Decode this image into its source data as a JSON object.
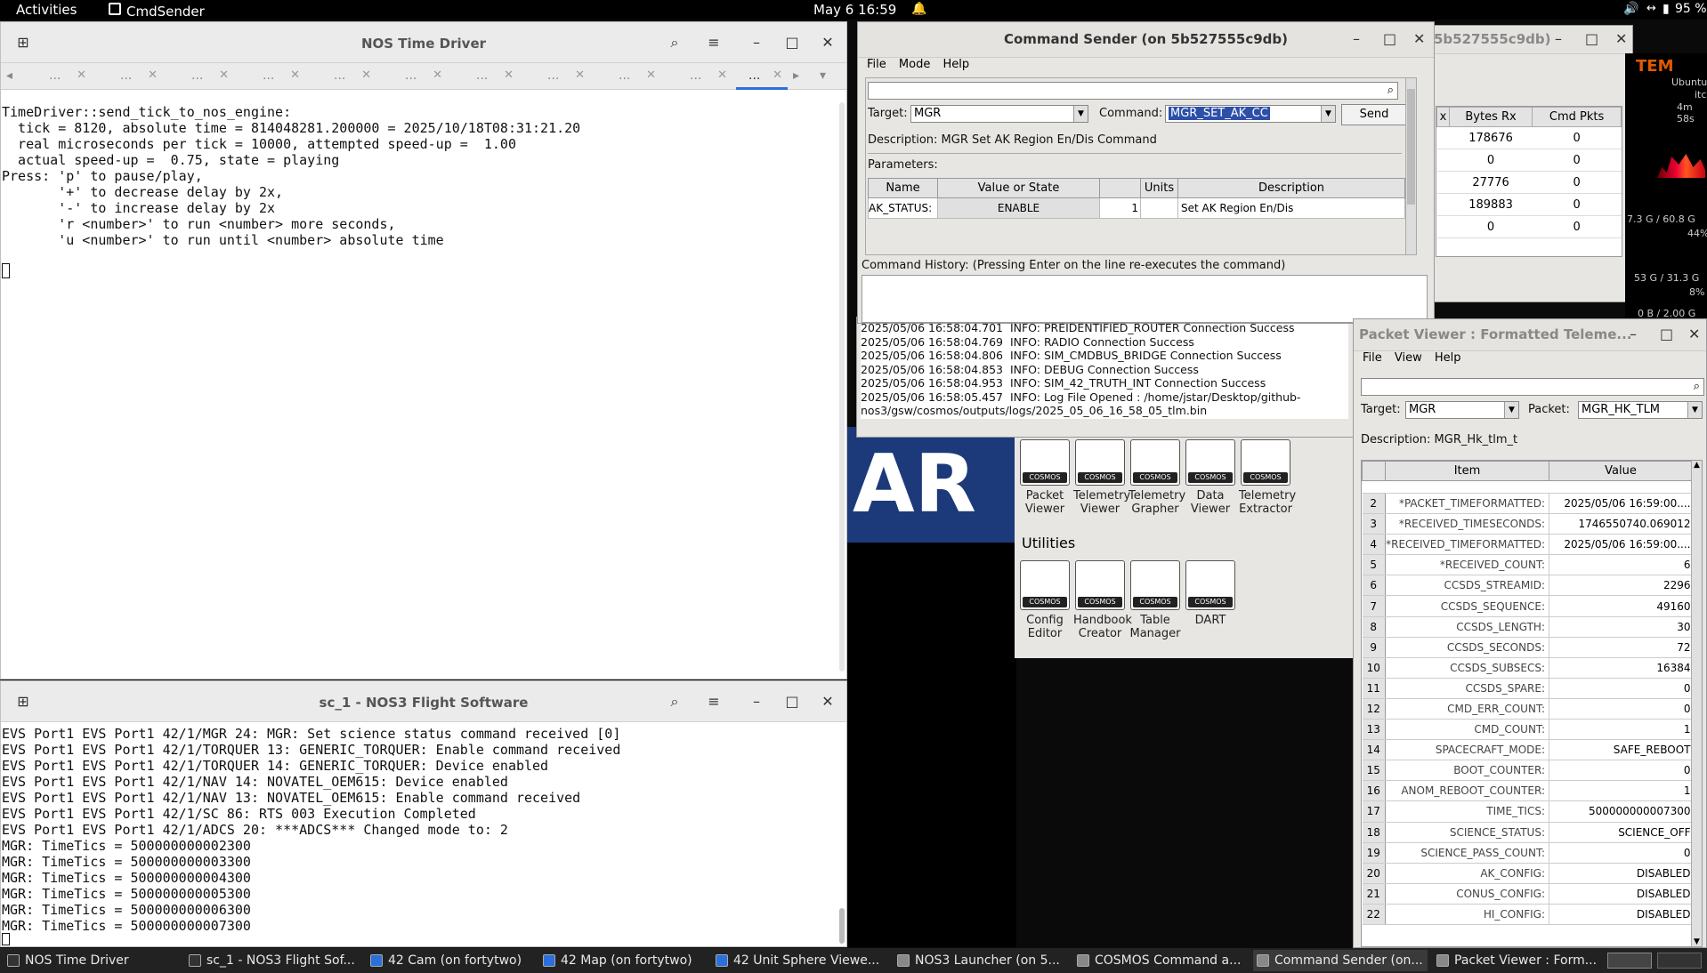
{
  "topbar": {
    "activities": "Activities",
    "app": "CmdSender",
    "clock": "May 6  16:59",
    "battery": "95 %"
  },
  "term1": {
    "title": "NOS Time Driver",
    "tab_label": "...",
    "lines": [
      "TimeDriver::send_tick_to_nos_engine:",
      "  tick = 8120, absolute time = 814048281.200000 = 2025/10/18T08:31:21.20",
      "  real microseconds per tick = 10000, attempted speed-up =  1.00",
      "  actual speed-up =  0.75, state = playing",
      "",
      "Press: 'p' to pause/play,",
      "       '+' to decrease delay by 2x,",
      "       '-' to increase delay by 2x",
      "       'r <number>' to run <number> more seconds,",
      "       'u <number>' to run until <number> absolute time"
    ]
  },
  "term2": {
    "title": "sc_1 - NOS3 Flight Software",
    "lines": [
      "EVS Port1 EVS Port1 42/1/MGR 24: MGR: Set science status command received [0]",
      "EVS Port1 EVS Port1 42/1/TORQUER 13: GENERIC_TORQUER: Enable command received",
      "EVS Port1 EVS Port1 42/1/TORQUER 14: GENERIC_TORQUER: Device enabled",
      "EVS Port1 EVS Port1 42/1/NAV 14: NOVATEL_OEM615: Device enabled",
      "EVS Port1 EVS Port1 42/1/NAV 13: NOVATEL_OEM615: Enable command received",
      "EVS Port1 EVS Port1 42/1/SC 86: RTS 003 Execution Completed",
      "EVS Port1 EVS Port1 42/1/ADCS 20: ***ADCS*** Changed mode to: 2",
      "MGR: TimeTics = 500000000002300",
      "MGR: TimeTics = 500000000003300",
      "MGR: TimeTics = 500000000004300",
      "MGR: TimeTics = 500000000005300",
      "MGR: TimeTics = 500000000006300",
      "MGR: TimeTics = 500000000007300"
    ]
  },
  "cmdsender": {
    "title": "Command Sender (on 5b527555c9db)",
    "menu": [
      "File",
      "Mode",
      "Help"
    ],
    "target_label": "Target:",
    "target": "MGR",
    "command_label": "Command:",
    "command": "MGR_SET_AK_CC",
    "send": "Send",
    "description": "Description:  MGR Set AK Region En/Dis Command",
    "parameters": "Parameters:",
    "param_headers": [
      "Name",
      "Value or State",
      "",
      "Units",
      "Description"
    ],
    "param_row": [
      "AK_STATUS:",
      "ENABLE",
      "1",
      "",
      "Set AK Region En/Dis"
    ],
    "history_label": "Command History: (Pressing Enter on the line re-executes the command)"
  },
  "bg_window": {
    "title": "5b527555c9db)",
    "headers": [
      "x",
      "Bytes Rx",
      "Cmd Pkts"
    ],
    "rows": [
      [
        "178676",
        "0"
      ],
      [
        "0",
        "0"
      ],
      [
        "27776",
        "0"
      ],
      [
        "189883",
        "0"
      ],
      [
        "0",
        "0"
      ]
    ],
    "side": [
      "TEM",
      "Ubuntu",
      "itc",
      "4m 58s",
      "7.3 G / 60.8 G",
      "44%",
      "53 G / 31.3 G",
      "8%",
      "0 B / 2.00 G"
    ]
  },
  "log": {
    "lines": [
      "2025/05/06 16:58:04.701  INFO: PREIDENTIFIED_ROUTER Connection Success",
      "2025/05/06 16:58:04.769  INFO: RADIO Connection Success",
      "2025/05/06 16:58:04.806  INFO: SIM_CMDBUS_BRIDGE Connection Success",
      "2025/05/06 16:58:04.853  INFO: DEBUG Connection Success",
      "2025/05/06 16:58:04.953  INFO: SIM_42_TRUTH_INT Connection Success",
      "2025/05/06 16:58:05.457  INFO: Log File Opened : /home/jstar/Desktop/github-",
      "nos3/gsw/cosmos/outputs/logs/2025_05_06_16_58_05_tlm.bin"
    ]
  },
  "launcher": {
    "tools": [
      "Packet\nViewer",
      "Telemetry\nViewer",
      "Telemetry\nGrapher",
      "Data\nViewer",
      "Telemetry\nExtractor"
    ],
    "utilities_label": "Utilities",
    "utils": [
      "Config\nEditor",
      "Handbook\nCreator",
      "Table\nManager",
      "DART"
    ]
  },
  "packetviewer": {
    "title": "Packet Viewer : Formatted Teleme...",
    "menu": [
      "File",
      "View",
      "Help"
    ],
    "target_label": "Target:",
    "target": "MGR",
    "packet_label": "Packet:",
    "packet": "MGR_HK_TLM",
    "description": "Description:  MGR_Hk_tlm_t",
    "headers": [
      "Item",
      "Value"
    ],
    "rows": [
      [
        "2",
        "*PACKET_TIMEFORMATTED:",
        "2025/05/06 16:59:00...."
      ],
      [
        "3",
        "*RECEIVED_TIMESECONDS:",
        "1746550740.069012"
      ],
      [
        "4",
        "*RECEIVED_TIMEFORMATTED:",
        "2025/05/06 16:59:00...."
      ],
      [
        "5",
        "*RECEIVED_COUNT:",
        "6"
      ],
      [
        "6",
        "CCSDS_STREAMID:",
        "2296"
      ],
      [
        "7",
        "CCSDS_SEQUENCE:",
        "49160"
      ],
      [
        "8",
        "CCSDS_LENGTH:",
        "30"
      ],
      [
        "9",
        "CCSDS_SECONDS:",
        "72"
      ],
      [
        "10",
        "CCSDS_SUBSECS:",
        "16384"
      ],
      [
        "11",
        "CCSDS_SPARE:",
        "0"
      ],
      [
        "12",
        "CMD_ERR_COUNT:",
        "0"
      ],
      [
        "13",
        "CMD_COUNT:",
        "1"
      ],
      [
        "14",
        "SPACECRAFT_MODE:",
        "SAFE_REBOOT"
      ],
      [
        "15",
        "BOOT_COUNTER:",
        "0"
      ],
      [
        "16",
        "ANOM_REBOOT_COUNTER:",
        "1"
      ],
      [
        "17",
        "TIME_TICS:",
        "500000000007300"
      ],
      [
        "18",
        "SCIENCE_STATUS:",
        "SCIENCE_OFF"
      ],
      [
        "19",
        "SCIENCE_PASS_COUNT:",
        "0"
      ],
      [
        "20",
        "AK_CONFIG:",
        "DISABLED"
      ],
      [
        "21",
        "CONUS_CONFIG:",
        "DISABLED"
      ],
      [
        "22",
        "HI_CONFIG:",
        "DISABLED"
      ]
    ]
  },
  "taskbar": {
    "items": [
      {
        "label": "NOS Time Driver",
        "color": "#333"
      },
      {
        "label": "sc_1 - NOS3 Flight Sof...",
        "color": "#333"
      },
      {
        "label": "42 Cam (on fortytwo)",
        "color": "#2a6fdb"
      },
      {
        "label": "42 Map (on fortytwo)",
        "color": "#2a6fdb"
      },
      {
        "label": "42 Unit Sphere Viewe...",
        "color": "#2a6fdb"
      },
      {
        "label": "NOS3 Launcher (on 5...",
        "color": "#888"
      },
      {
        "label": "COSMOS Command a...",
        "color": "#888"
      },
      {
        "label": "Command Sender (on...",
        "color": "#888"
      },
      {
        "label": "Packet Viewer : Form...",
        "color": "#888"
      }
    ]
  }
}
